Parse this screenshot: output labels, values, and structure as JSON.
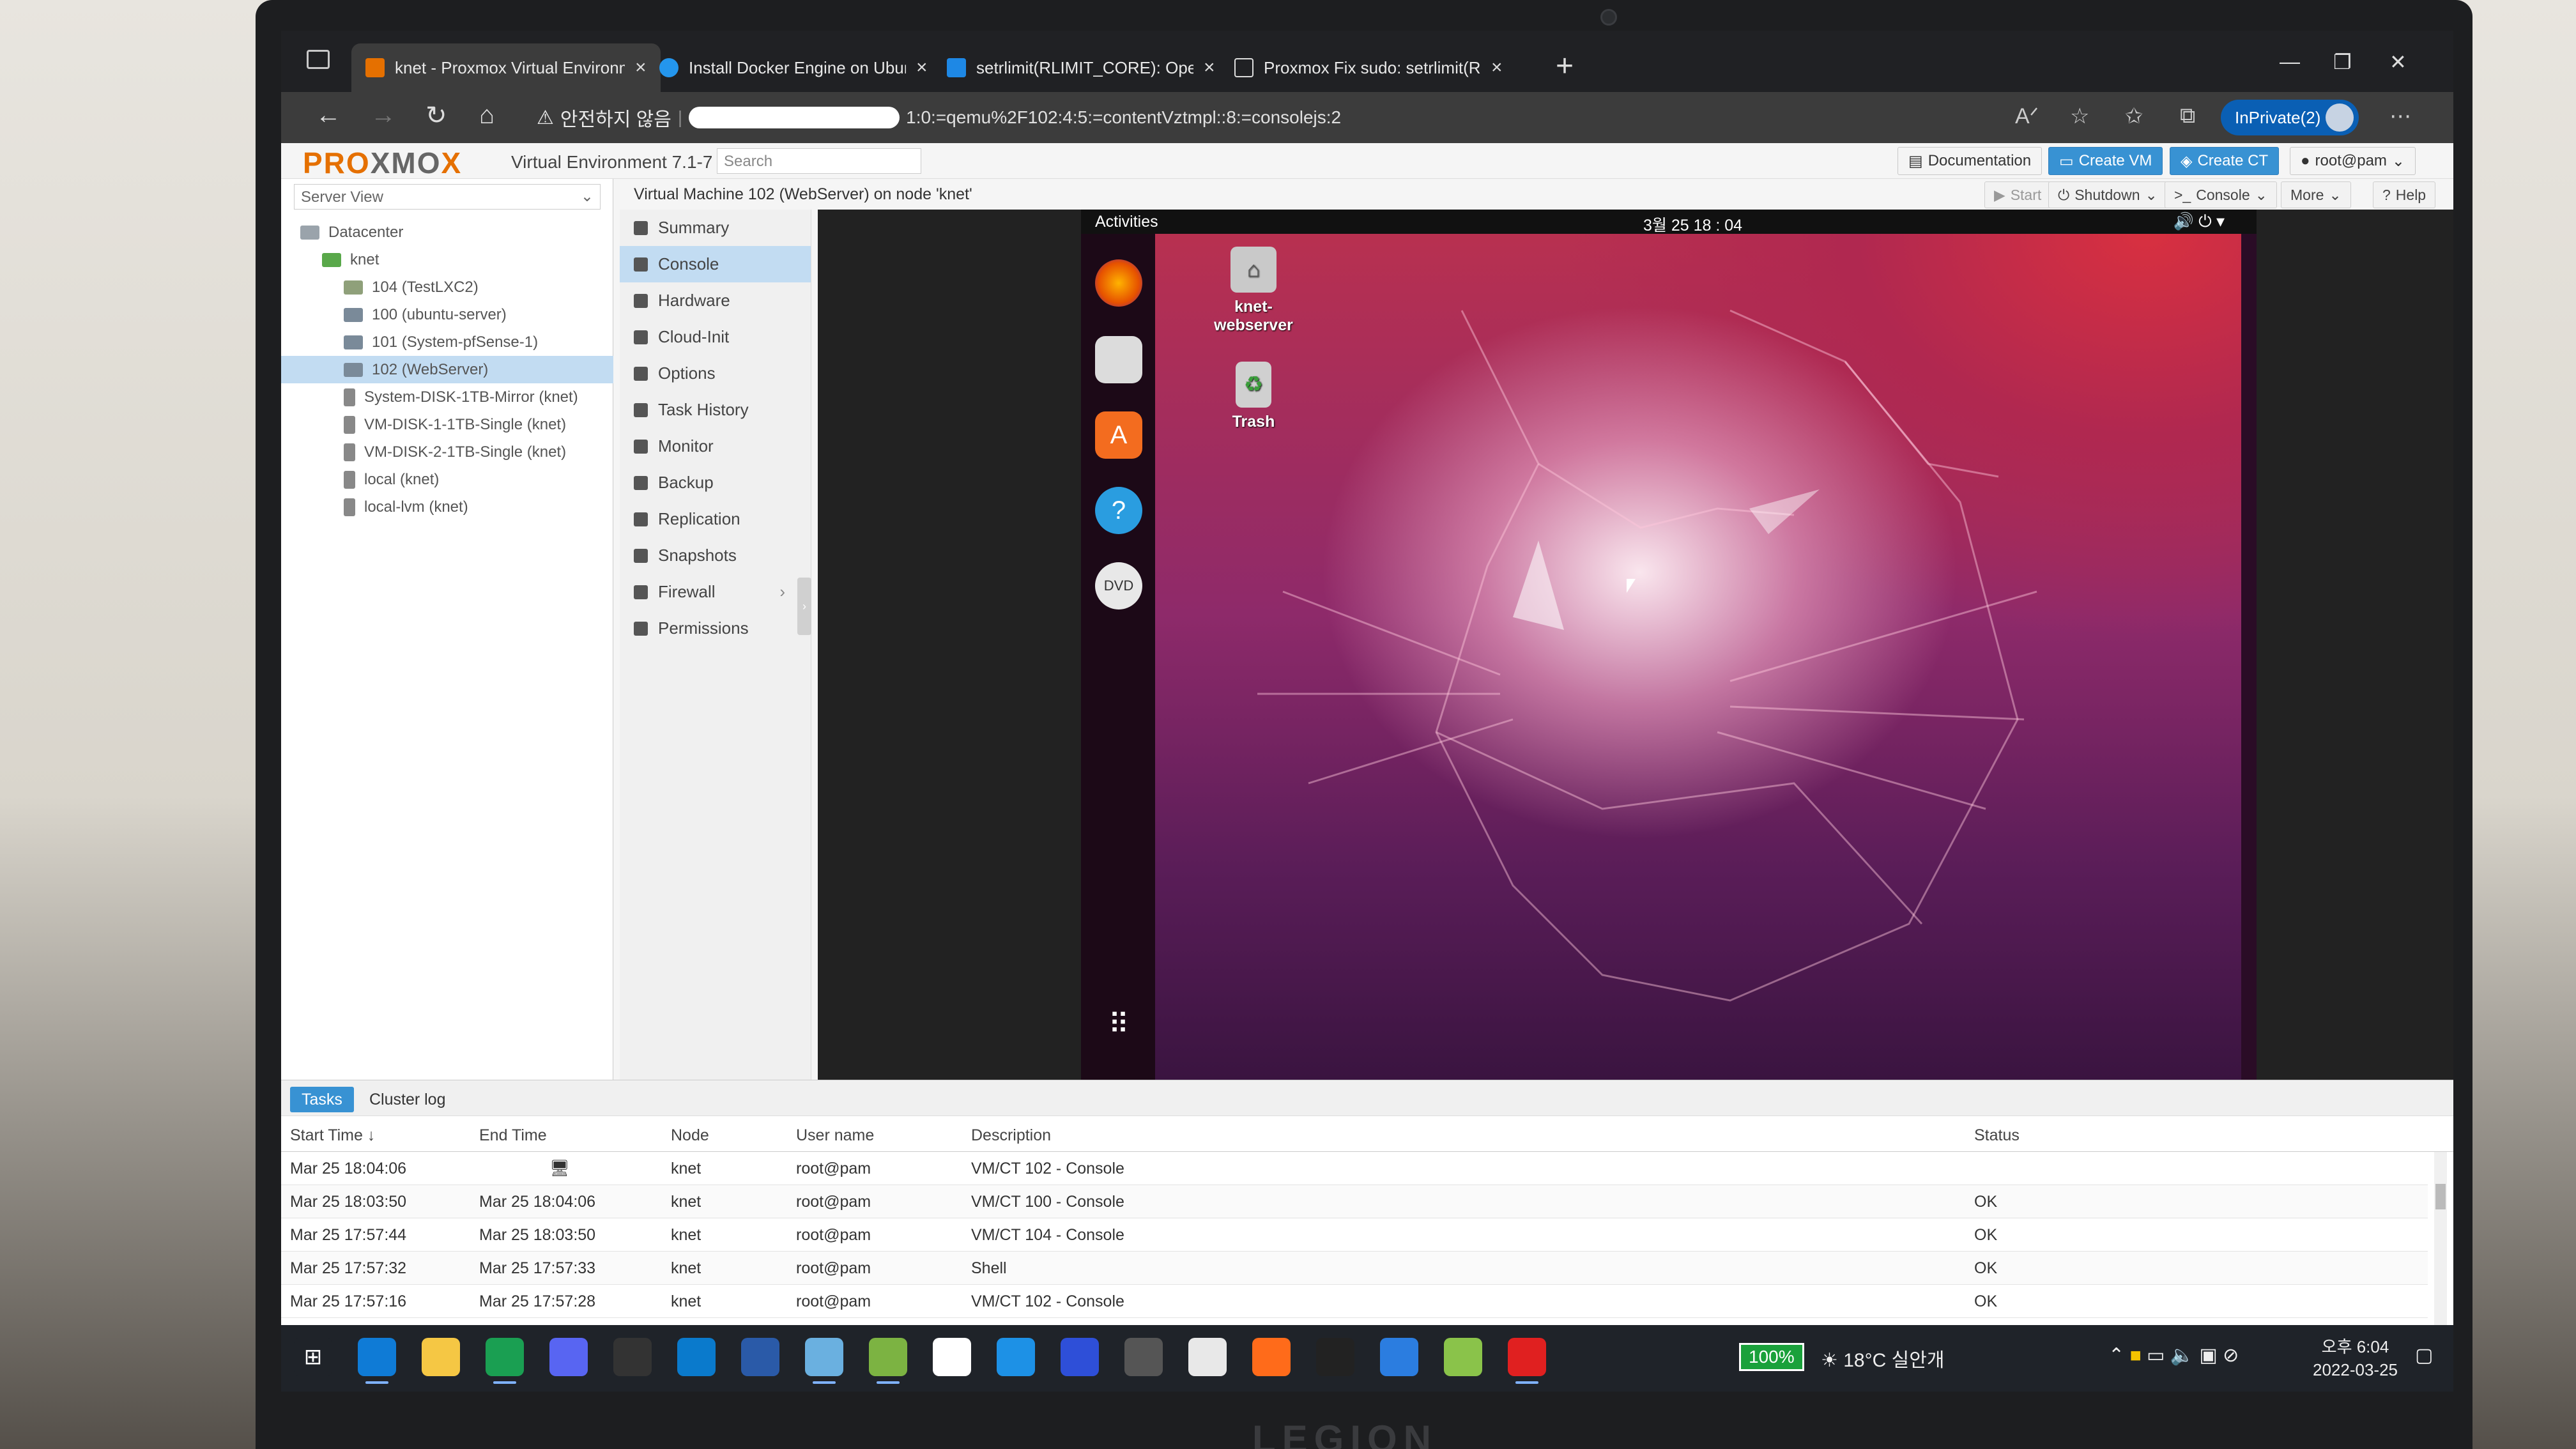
{
  "browser": {
    "tabs": [
      {
        "label": "knet - Proxmox Virtual Environm",
        "active": true,
        "favicon": "proxmox-x-icon"
      },
      {
        "label": "Install Docker Engine on Ubuntu",
        "active": false,
        "favicon": "docker-icon"
      },
      {
        "label": "setrlimit(RLIMIT_CORE): Operatio",
        "active": false,
        "favicon": "bing-icon"
      },
      {
        "label": "Proxmox Fix sudo: setrlimit(RLIM",
        "active": false,
        "favicon": "page-icon"
      }
    ],
    "security_warning": "안전하지 않음",
    "url_suffix": "1:0:=qemu%2F102:4:5:=contentVztmpl::8:=consolejs:2",
    "inprivate_label": "InPrivate(2)"
  },
  "pve": {
    "logo_left": "PRO",
    "logo_mid": "XMO",
    "logo_right": "X",
    "product": "Virtual Environment 7.1-7",
    "search_placeholder": "Search",
    "top_buttons": {
      "documentation": "Documentation",
      "create_vm": "Create VM",
      "create_ct": "Create CT",
      "user": "root@pam"
    },
    "server_view": "Server View",
    "tree": [
      {
        "label": "Datacenter",
        "type": "dc",
        "indent": 0,
        "selected": false
      },
      {
        "label": "knet",
        "type": "node",
        "indent": 1,
        "selected": false
      },
      {
        "label": "104 (TestLXC2)",
        "type": "lxc",
        "indent": 2,
        "selected": false
      },
      {
        "label": "100 (ubuntu-server)",
        "type": "vm",
        "indent": 2,
        "selected": false
      },
      {
        "label": "101 (System-pfSense-1)",
        "type": "vm",
        "indent": 2,
        "selected": false
      },
      {
        "label": "102 (WebServer)",
        "type": "vm",
        "indent": 2,
        "selected": true
      },
      {
        "label": "System-DISK-1TB-Mirror (knet)",
        "type": "disk",
        "indent": 2,
        "selected": false
      },
      {
        "label": "VM-DISK-1-1TB-Single (knet)",
        "type": "disk",
        "indent": 2,
        "selected": false
      },
      {
        "label": "VM-DISK-2-1TB-Single (knet)",
        "type": "disk",
        "indent": 2,
        "selected": false
      },
      {
        "label": "local (knet)",
        "type": "disk",
        "indent": 2,
        "selected": false
      },
      {
        "label": "local-lvm (knet)",
        "type": "disk",
        "indent": 2,
        "selected": false
      }
    ],
    "vm_title": "Virtual Machine 102 (WebServer) on node 'knet'",
    "vm_buttons": {
      "start": "Start",
      "shutdown": "Shutdown",
      "console": "Console",
      "more": "More",
      "help": "Help"
    },
    "menu": [
      {
        "label": "Summary",
        "icon": "summary-icon",
        "selected": false
      },
      {
        "label": "Console",
        "icon": "terminal-icon",
        "selected": true
      },
      {
        "label": "Hardware",
        "icon": "monitor-icon",
        "selected": false
      },
      {
        "label": "Cloud-Init",
        "icon": "cloud-icon",
        "selected": false
      },
      {
        "label": "Options",
        "icon": "gear-icon",
        "selected": false
      },
      {
        "label": "Task History",
        "icon": "list-icon",
        "selected": false
      },
      {
        "label": "Monitor",
        "icon": "eye-icon",
        "selected": false
      },
      {
        "label": "Backup",
        "icon": "floppy-icon",
        "selected": false
      },
      {
        "label": "Replication",
        "icon": "retweet-icon",
        "selected": false
      },
      {
        "label": "Snapshots",
        "icon": "history-icon",
        "selected": false
      },
      {
        "label": "Firewall",
        "icon": "shield-icon",
        "selected": false,
        "has_submenu": true
      },
      {
        "label": "Permissions",
        "icon": "unlock-icon",
        "selected": false
      }
    ],
    "console": {
      "activities": "Activities",
      "clock": "3월 25 18 : 04",
      "desktop_icons": [
        {
          "label": "knet-webserver",
          "icon": "home-folder-icon"
        },
        {
          "label": "Trash",
          "icon": "trash-icon"
        }
      ],
      "dock_apps": [
        "firefox-icon",
        "files-icon",
        "software-center-icon",
        "help-icon",
        "dvd-icon",
        "app-grid-icon"
      ]
    },
    "bottom_tabs": {
      "tasks": "Tasks",
      "cluster_log": "Cluster log"
    },
    "task_columns": {
      "start": "Start Time ↓",
      "end": "End Time",
      "node": "Node",
      "user": "User name",
      "desc": "Description",
      "status": "Status"
    },
    "tasks": [
      {
        "start": "Mar 25 18:04:06",
        "end": "",
        "node": "knet",
        "user": "root@pam",
        "desc": "VM/CT 102 - Console",
        "status": "",
        "running": true
      },
      {
        "start": "Mar 25 18:03:50",
        "end": "Mar 25 18:04:06",
        "node": "knet",
        "user": "root@pam",
        "desc": "VM/CT 100 - Console",
        "status": "OK"
      },
      {
        "start": "Mar 25 17:57:44",
        "end": "Mar 25 18:03:50",
        "node": "knet",
        "user": "root@pam",
        "desc": "VM/CT 104 - Console",
        "status": "OK"
      },
      {
        "start": "Mar 25 17:57:32",
        "end": "Mar 25 17:57:33",
        "node": "knet",
        "user": "root@pam",
        "desc": "Shell",
        "status": "OK"
      },
      {
        "start": "Mar 25 17:57:16",
        "end": "Mar 25 17:57:28",
        "node": "knet",
        "user": "root@pam",
        "desc": "VM/CT 102 - Console",
        "status": "OK"
      }
    ]
  },
  "taskbar": {
    "battery": "100%",
    "weather": "18°C 실안개",
    "time": "오후 6:04",
    "date": "2022-03-25",
    "apps": [
      "windows-start-icon",
      "edge-icon",
      "file-explorer-icon",
      "chrome-icon",
      "discord-icon",
      "github-icon",
      "vscode-icon",
      "powershell-icon",
      "snipping-icon",
      "notepadpp-icon",
      "word-icon",
      "docker-icon",
      "intellij-icon",
      "obs-icon",
      "camera-icon",
      "dex-icon",
      "terminal-icon",
      "network-icon",
      "git-icon",
      "youtube-icon"
    ]
  },
  "colors": {
    "pve_orange": "#e57000",
    "pve_blue": "#3892d3",
    "selection": "#c2dcf2",
    "ubuntu_purple": "#5a1d58"
  }
}
